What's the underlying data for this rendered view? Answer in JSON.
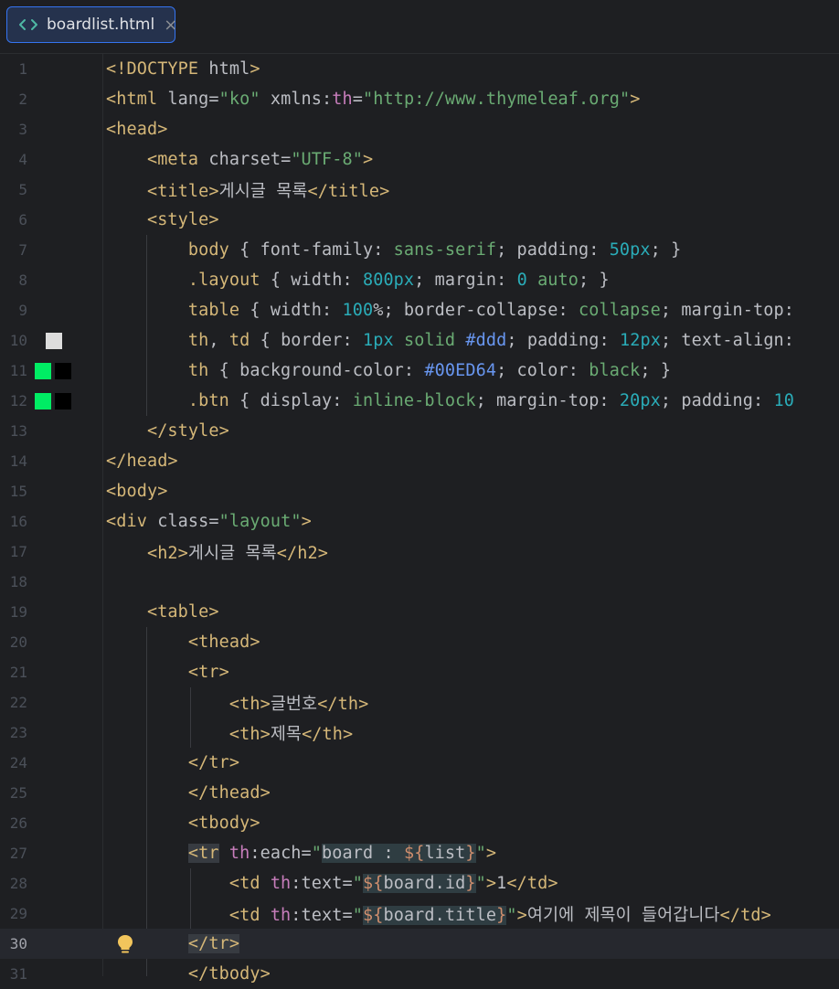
{
  "tab": {
    "filename": "boardlist.html",
    "close": "×"
  },
  "icons": {
    "file": "html-file-icon",
    "close": "close-icon",
    "bulb": "lightbulb-icon"
  },
  "colors": {
    "accent": "#3574f0",
    "swatch_ddd": "#dddddd",
    "swatch_green": "#00ED64",
    "swatch_black": "#000000"
  },
  "current_line": 30,
  "lines": [
    {
      "n": "1",
      "tokens": [
        [
          "tg",
          "<!DOCTYPE "
        ],
        [
          "at",
          "html"
        ],
        [
          "tg",
          ">"
        ]
      ]
    },
    {
      "n": "2",
      "tokens": [
        [
          "tg",
          "<html "
        ],
        [
          "at",
          "lang"
        ],
        [
          "plain",
          "="
        ],
        [
          "str",
          "\"ko\""
        ],
        [
          "plain",
          " "
        ],
        [
          "at",
          "xmlns"
        ],
        [
          "plain",
          ":"
        ],
        [
          "th-attr",
          "th"
        ],
        [
          "plain",
          "="
        ],
        [
          "str",
          "\"http://www.thymeleaf.org\""
        ],
        [
          "tg",
          ">"
        ]
      ]
    },
    {
      "n": "3",
      "tokens": [
        [
          "tg",
          "<head>"
        ]
      ]
    },
    {
      "n": "4",
      "tokens": [
        [
          "plain",
          "    "
        ],
        [
          "tg",
          "<meta "
        ],
        [
          "at",
          "charset"
        ],
        [
          "plain",
          "="
        ],
        [
          "str",
          "\"UTF-8\""
        ],
        [
          "tg",
          ">"
        ]
      ]
    },
    {
      "n": "5",
      "tokens": [
        [
          "plain",
          "    "
        ],
        [
          "tg",
          "<title>"
        ],
        [
          "plain",
          "게시글 목록"
        ],
        [
          "tg",
          "</title>"
        ]
      ]
    },
    {
      "n": "6",
      "tokens": [
        [
          "plain",
          "    "
        ],
        [
          "tg",
          "<style>"
        ]
      ]
    },
    {
      "n": "7",
      "tokens": [
        [
          "plain",
          "        "
        ],
        [
          "tg",
          "body"
        ],
        [
          "plain",
          " { font-family: "
        ],
        [
          "kw",
          "sans-serif"
        ],
        [
          "plain",
          "; padding: "
        ],
        [
          "num",
          "50px"
        ],
        [
          "plain",
          "; }"
        ]
      ]
    },
    {
      "n": "8",
      "tokens": [
        [
          "plain",
          "        "
        ],
        [
          "tg",
          ".layout"
        ],
        [
          "plain",
          " { width: "
        ],
        [
          "num",
          "800px"
        ],
        [
          "plain",
          "; margin: "
        ],
        [
          "num",
          "0"
        ],
        [
          "plain",
          " "
        ],
        [
          "kw",
          "auto"
        ],
        [
          "plain",
          "; }"
        ]
      ]
    },
    {
      "n": "9",
      "tokens": [
        [
          "plain",
          "        "
        ],
        [
          "tg",
          "table"
        ],
        [
          "plain",
          " { width: "
        ],
        [
          "num",
          "100"
        ],
        [
          "plain",
          "%; border-collapse: "
        ],
        [
          "kw",
          "collapse"
        ],
        [
          "plain",
          "; margin-top:"
        ]
      ]
    },
    {
      "n": "10",
      "swatches": [
        "light"
      ],
      "tokens": [
        [
          "plain",
          "        "
        ],
        [
          "tg",
          "th"
        ],
        [
          "plain",
          ", "
        ],
        [
          "tg",
          "td"
        ],
        [
          "plain",
          " { border: "
        ],
        [
          "num",
          "1px"
        ],
        [
          "plain",
          " "
        ],
        [
          "kw",
          "solid"
        ],
        [
          "plain",
          " "
        ],
        [
          "hex",
          "#ddd"
        ],
        [
          "plain",
          "; padding: "
        ],
        [
          "num",
          "12px"
        ],
        [
          "plain",
          "; text-align:"
        ]
      ]
    },
    {
      "n": "11",
      "swatches": [
        "green",
        "black"
      ],
      "tokens": [
        [
          "plain",
          "        "
        ],
        [
          "tg",
          "th"
        ],
        [
          "plain",
          " { background-color: "
        ],
        [
          "hex",
          "#00ED64"
        ],
        [
          "plain",
          "; color: "
        ],
        [
          "kw",
          "black"
        ],
        [
          "plain",
          "; }"
        ]
      ]
    },
    {
      "n": "12",
      "swatches": [
        "green",
        "black"
      ],
      "tokens": [
        [
          "plain",
          "        "
        ],
        [
          "tg",
          ".btn"
        ],
        [
          "plain",
          " { display: "
        ],
        [
          "kw",
          "inline-block"
        ],
        [
          "plain",
          "; margin-top: "
        ],
        [
          "num",
          "20px"
        ],
        [
          "plain",
          "; padding: "
        ],
        [
          "num",
          "10"
        ]
      ]
    },
    {
      "n": "13",
      "tokens": [
        [
          "plain",
          "    "
        ],
        [
          "tg",
          "</style>"
        ]
      ]
    },
    {
      "n": "14",
      "tokens": [
        [
          "tg",
          "</head>"
        ]
      ]
    },
    {
      "n": "15",
      "tokens": [
        [
          "tg",
          "<body>"
        ]
      ]
    },
    {
      "n": "16",
      "tokens": [
        [
          "tg",
          "<div "
        ],
        [
          "at",
          "class"
        ],
        [
          "plain",
          "="
        ],
        [
          "str",
          "\"layout\""
        ],
        [
          "tg",
          ">"
        ]
      ]
    },
    {
      "n": "17",
      "tokens": [
        [
          "plain",
          "    "
        ],
        [
          "tg",
          "<h2>"
        ],
        [
          "plain",
          "게시글 목록"
        ],
        [
          "tg",
          "</h2>"
        ]
      ]
    },
    {
      "n": "18",
      "tokens": []
    },
    {
      "n": "19",
      "tokens": [
        [
          "plain",
          "    "
        ],
        [
          "tg",
          "<table>"
        ]
      ]
    },
    {
      "n": "20",
      "tokens": [
        [
          "plain",
          "        "
        ],
        [
          "tg",
          "<thead>"
        ]
      ]
    },
    {
      "n": "21",
      "tokens": [
        [
          "plain",
          "        "
        ],
        [
          "tg",
          "<tr>"
        ]
      ]
    },
    {
      "n": "22",
      "tokens": [
        [
          "plain",
          "            "
        ],
        [
          "tg",
          "<th>"
        ],
        [
          "plain",
          "글번호"
        ],
        [
          "tg",
          "</th>"
        ]
      ]
    },
    {
      "n": "23",
      "tokens": [
        [
          "plain",
          "            "
        ],
        [
          "tg",
          "<th>"
        ],
        [
          "plain",
          "제목"
        ],
        [
          "tg",
          "</th>"
        ]
      ]
    },
    {
      "n": "24",
      "tokens": [
        [
          "plain",
          "        "
        ],
        [
          "tg",
          "</tr>"
        ]
      ]
    },
    {
      "n": "25",
      "tokens": [
        [
          "plain",
          "        "
        ],
        [
          "tg",
          "</thead>"
        ]
      ]
    },
    {
      "n": "26",
      "tokens": [
        [
          "plain",
          "        "
        ],
        [
          "tg",
          "<tbody>"
        ]
      ]
    },
    {
      "n": "27",
      "tokens": [
        [
          "plain",
          "        "
        ],
        [
          "tg hl2",
          "<tr"
        ],
        [
          "plain",
          " "
        ],
        [
          "th-attr",
          "th"
        ],
        [
          "plain",
          ":each="
        ],
        [
          "str",
          "\""
        ],
        [
          "plain hl",
          "board : "
        ],
        [
          "expr hl",
          "${"
        ],
        [
          "plain hl",
          "list"
        ],
        [
          "expr hl",
          "}"
        ],
        [
          "str",
          "\""
        ],
        [
          "tg",
          ">"
        ]
      ]
    },
    {
      "n": "28",
      "tokens": [
        [
          "plain",
          "            "
        ],
        [
          "tg",
          "<td "
        ],
        [
          "th-attr",
          "th"
        ],
        [
          "plain",
          ":text="
        ],
        [
          "str",
          "\""
        ],
        [
          "expr hl",
          "${"
        ],
        [
          "plain hl",
          "board.id"
        ],
        [
          "expr hl",
          "}"
        ],
        [
          "str",
          "\""
        ],
        [
          "tg",
          ">"
        ],
        [
          "plain",
          "1"
        ],
        [
          "tg",
          "</td>"
        ]
      ]
    },
    {
      "n": "29",
      "tokens": [
        [
          "plain",
          "            "
        ],
        [
          "tg",
          "<td "
        ],
        [
          "th-attr",
          "th"
        ],
        [
          "plain",
          ":text="
        ],
        [
          "str",
          "\""
        ],
        [
          "expr hl",
          "${"
        ],
        [
          "plain hl",
          "board.title"
        ],
        [
          "expr hl",
          "}"
        ],
        [
          "str",
          "\""
        ],
        [
          "tg",
          ">"
        ],
        [
          "plain",
          "여기에 제목이 들어갑니다"
        ],
        [
          "tg",
          "</td>"
        ]
      ]
    },
    {
      "n": "30",
      "bulb": true,
      "tokens": [
        [
          "plain",
          "        "
        ],
        [
          "tg hl2",
          "</tr>"
        ]
      ]
    },
    {
      "n": "31",
      "tokens": [
        [
          "plain",
          "        "
        ],
        [
          "tg",
          "</tbody>"
        ]
      ]
    }
  ]
}
